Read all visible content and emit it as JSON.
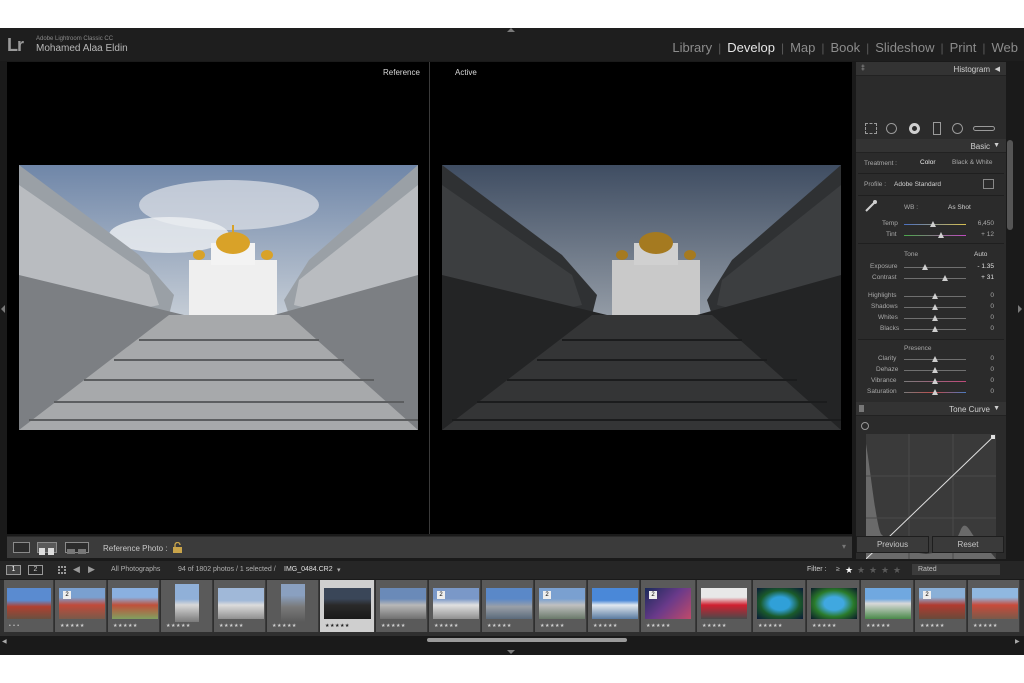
{
  "identity": {
    "logo": "Lr",
    "app_name": "Adobe Lightroom Classic CC",
    "user_name": "Mohamed Alaa Eldin"
  },
  "modules": [
    "Library",
    "Develop",
    "Map",
    "Book",
    "Slideshow",
    "Print",
    "Web"
  ],
  "active_module": "Develop",
  "view": {
    "left_label": "Reference",
    "right_label": "Active"
  },
  "toolbar": {
    "reference_photo_label": "Reference Photo :"
  },
  "panel": {
    "histogram_title": "Histogram",
    "basic_title": "Basic",
    "treatment_label": "Treatment :",
    "treatment_color": "Color",
    "treatment_bw": "Black & White",
    "profile_label": "Profile :",
    "profile_value": "Adobe Standard",
    "wb_label": "WB :",
    "wb_value": "As Shot",
    "temp_label": "Temp",
    "temp_value": "6,450",
    "tint_label": "Tint",
    "tint_value": "+ 12",
    "tone_label": "Tone",
    "tone_auto": "Auto",
    "exposure_label": "Exposure",
    "exposure_value": "- 1.35",
    "contrast_label": "Contrast",
    "contrast_value": "+ 31",
    "highlights_label": "Highlights",
    "highlights_value": "0",
    "shadows_label": "Shadows",
    "shadows_value": "0",
    "whites_label": "Whites",
    "whites_value": "0",
    "blacks_label": "Blacks",
    "blacks_value": "0",
    "presence_label": "Presence",
    "clarity_label": "Clarity",
    "clarity_value": "0",
    "dehaze_label": "Dehaze",
    "dehaze_value": "0",
    "vibrance_label": "Vibrance",
    "vibrance_value": "0",
    "saturation_label": "Saturation",
    "saturation_value": "0",
    "tone_curve_title": "Tone Curve",
    "previous_button": "Previous",
    "reset_button": "Reset"
  },
  "filmstrip_bar": {
    "page1": "1",
    "page2": "2",
    "source": "All Photographs",
    "count_text": "94 of 1802 photos / 1 selected /",
    "filename": "IMG_0484.CR2",
    "filter_label": "Filter :",
    "rating_op": "≥",
    "rated_option": "Rated"
  },
  "thumbs": [
    {
      "badge": "",
      "stars": "• • •"
    },
    {
      "badge": "2",
      "stars": "★★★★★"
    },
    {
      "badge": "",
      "stars": "★★★★★"
    },
    {
      "badge": "",
      "stars": "★★★★★"
    },
    {
      "badge": "",
      "stars": "★★★★★"
    },
    {
      "badge": "",
      "stars": "★★★★★"
    },
    {
      "badge": "",
      "stars": "★★★★★"
    },
    {
      "badge": "",
      "stars": "★★★★★"
    },
    {
      "badge": "2",
      "stars": "★★★★★"
    },
    {
      "badge": "",
      "stars": "★★★★★"
    },
    {
      "badge": "2",
      "stars": "★★★★★"
    },
    {
      "badge": "",
      "stars": "★★★★★"
    },
    {
      "badge": "2",
      "stars": "★★★★★"
    },
    {
      "badge": "",
      "stars": "★★★★★"
    },
    {
      "badge": "",
      "stars": "★★★★★"
    },
    {
      "badge": "",
      "stars": "★★★★★"
    },
    {
      "badge": "",
      "stars": "★★★★★"
    },
    {
      "badge": "2",
      "stars": "★★★★★"
    },
    {
      "badge": "",
      "stars": "★★★★★"
    }
  ],
  "colors": {
    "active_text": "#e6e6e6",
    "inactive_text": "#8c8c8c",
    "panel_bg": "#2b2b2b"
  }
}
